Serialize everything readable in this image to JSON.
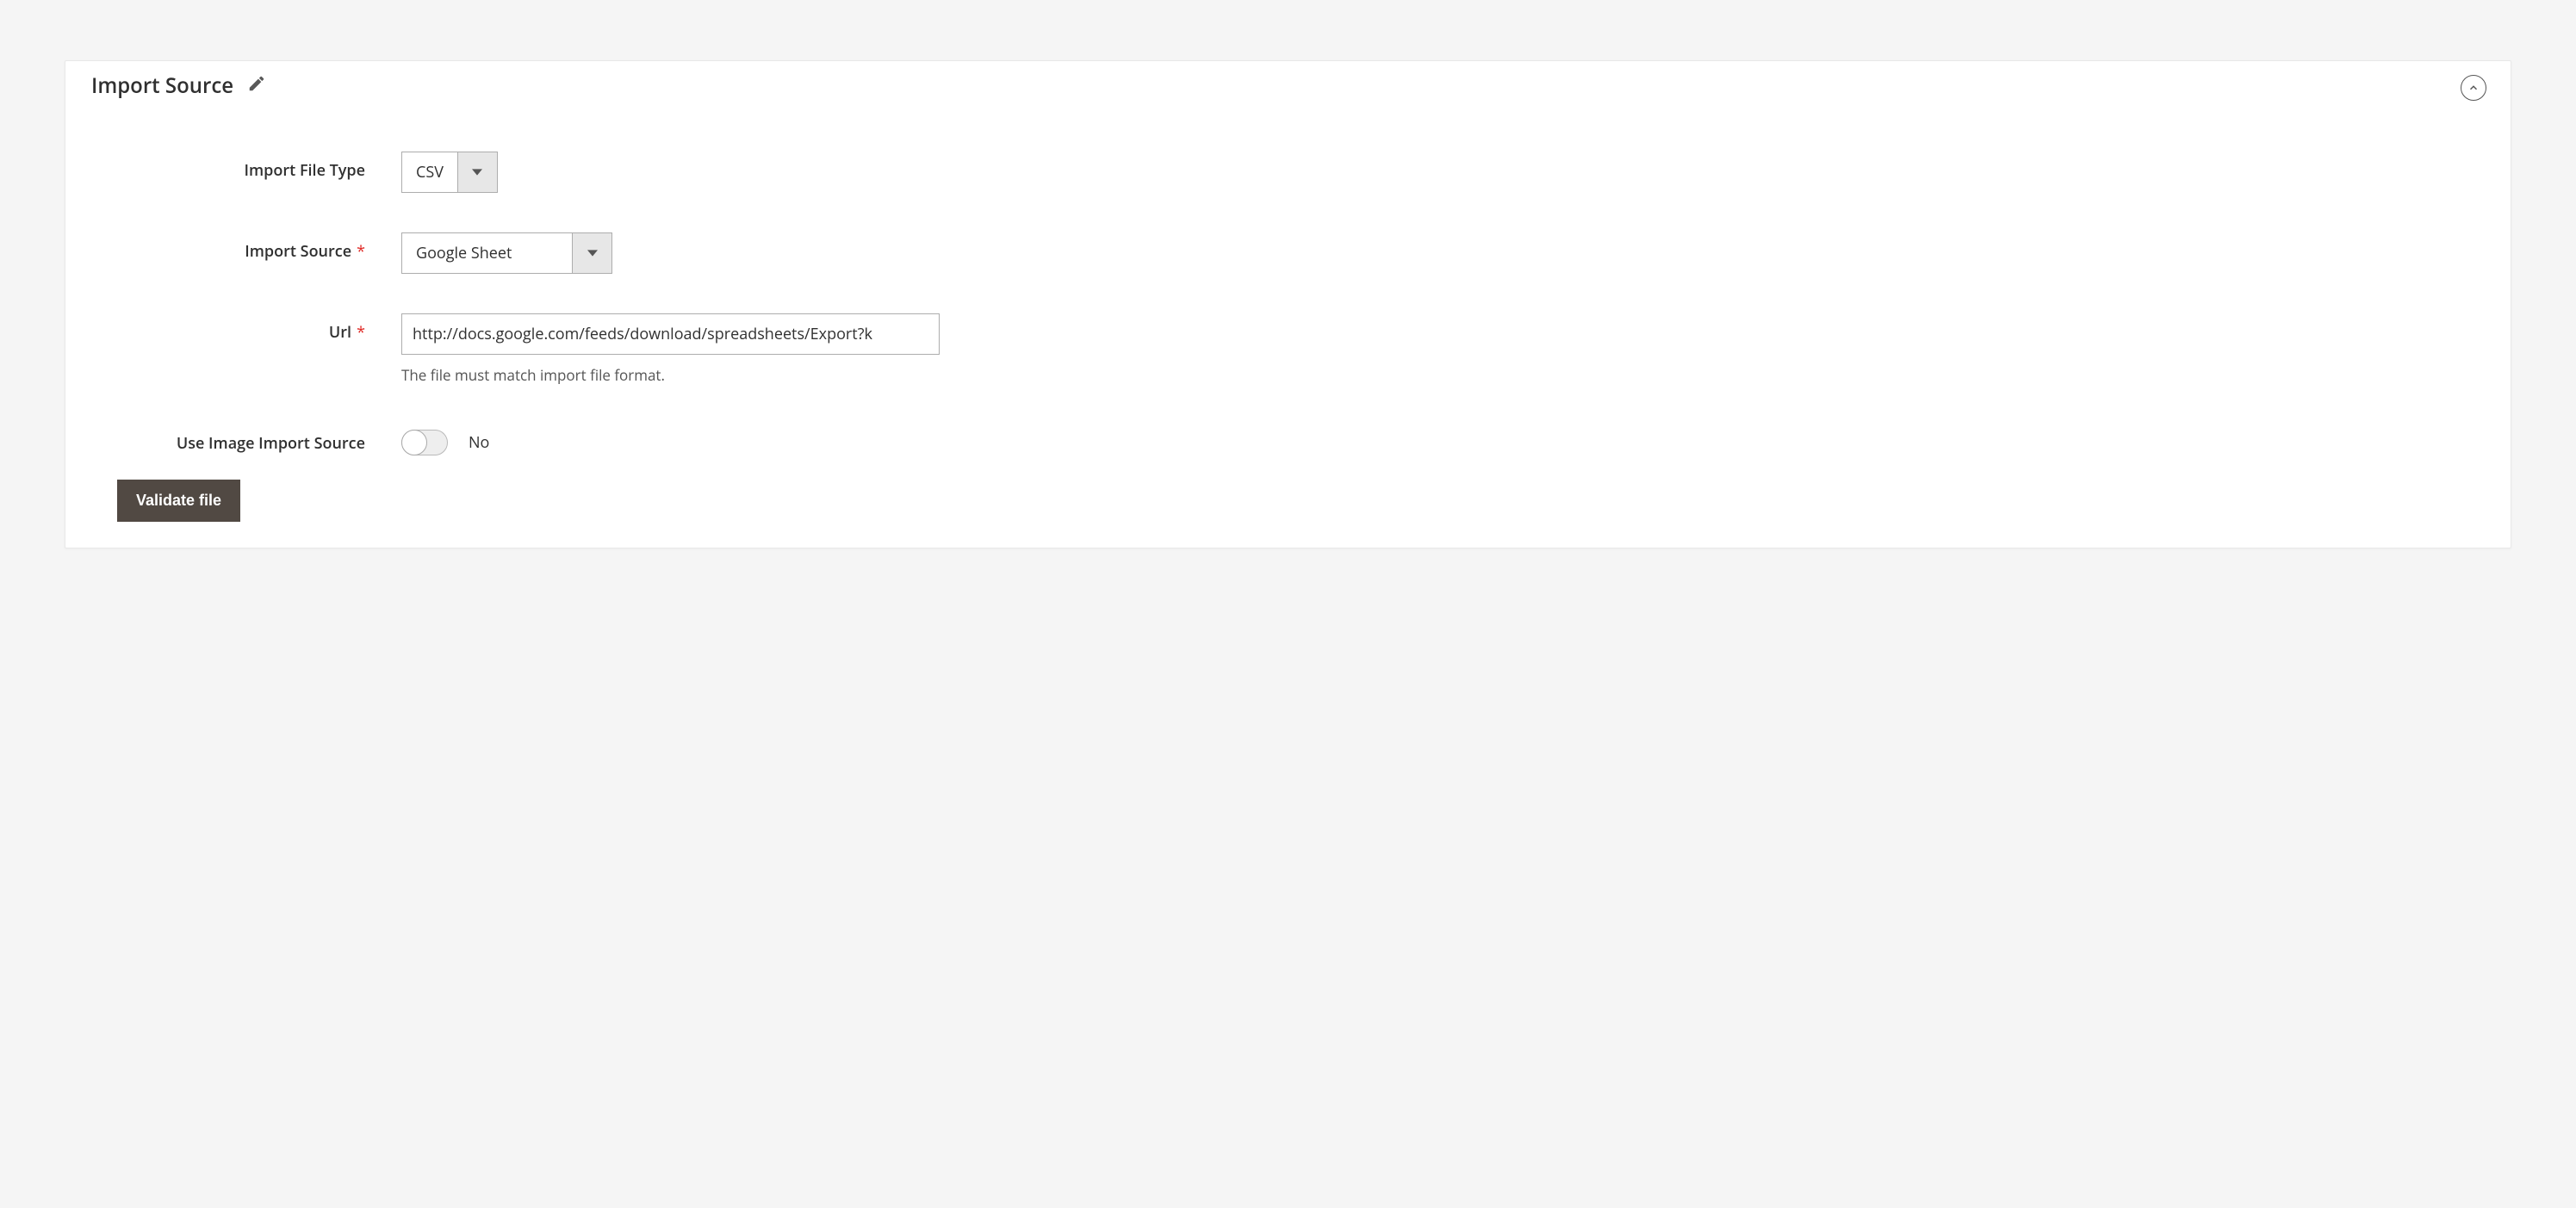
{
  "panel": {
    "title": "Import Source"
  },
  "fields": {
    "file_type": {
      "label": "Import File Type",
      "value": "CSV"
    },
    "import_source": {
      "label": "Import Source",
      "value": "Google Sheet"
    },
    "url": {
      "label": "Url",
      "value": "http://docs.google.com/feeds/download/spreadsheets/Export?k",
      "help": "The file must match import file format."
    },
    "image_source": {
      "label": "Use Image Import Source",
      "value": "No"
    }
  },
  "buttons": {
    "validate": "Validate file"
  }
}
